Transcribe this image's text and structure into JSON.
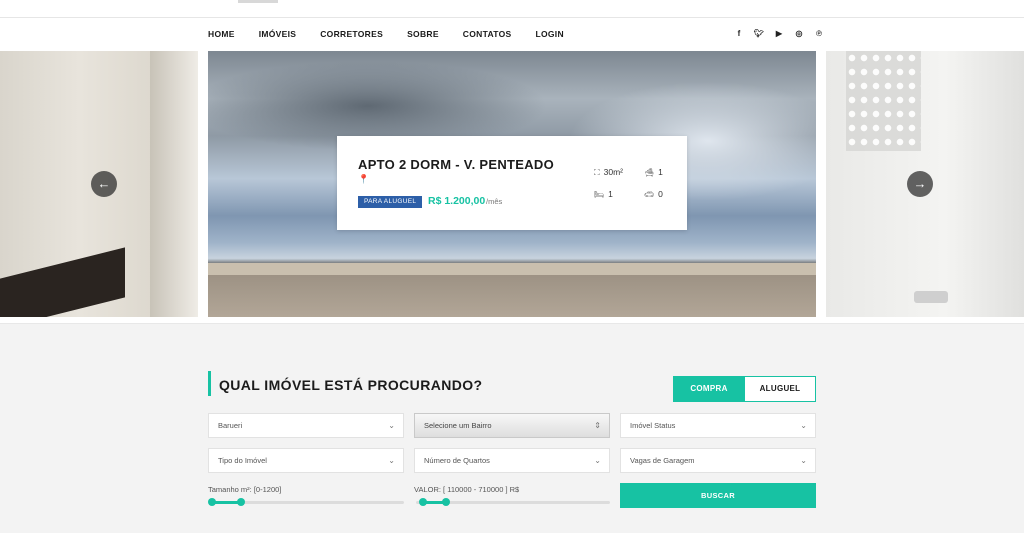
{
  "nav": {
    "items": [
      "HOME",
      "IMÓVEIS",
      "CORRETORES",
      "SOBRE",
      "CONTATOS",
      "LOGIN"
    ],
    "social": [
      {
        "icon": "facebook-icon",
        "glyph": "f"
      },
      {
        "icon": "twitter-icon",
        "glyph": "🐦"
      },
      {
        "icon": "youtube-icon",
        "glyph": "▶"
      },
      {
        "icon": "instagram-icon",
        "glyph": "◎"
      },
      {
        "icon": "pinterest-icon",
        "glyph": "℗"
      }
    ]
  },
  "slider": {
    "prev_arrow": "←",
    "next_arrow": "→"
  },
  "card": {
    "title": "APTO 2 DORM - V. PENTEADO",
    "location_icon": "📍",
    "badge": "PARA ALUGUEL",
    "price": "R$ 1.200,00",
    "period": "/mês",
    "area": "30m²",
    "bathrooms": "1",
    "bedrooms": "1",
    "garage": "0"
  },
  "search": {
    "heading": "QUAL IMÓVEL ESTÁ PROCURANDO?",
    "tab_compra": "COMPRA",
    "tab_aluguel": "ALUGUEL",
    "city": "Barueri",
    "bairro": "Selecione um Bairro",
    "status": "Imóvel Status",
    "tipo": "Tipo do Imóvel",
    "quartos": "Número de Quartos",
    "vagas": "Vagas de Garagem",
    "tamanho_label": "Tamanho m²: [0-1200]",
    "valor_label": "VALOR: [ 110000 - 710000 ] R$",
    "buscar": "BUSCAR"
  },
  "colors": {
    "accent": "#17c2a3",
    "badge": "#2d5fa8"
  }
}
